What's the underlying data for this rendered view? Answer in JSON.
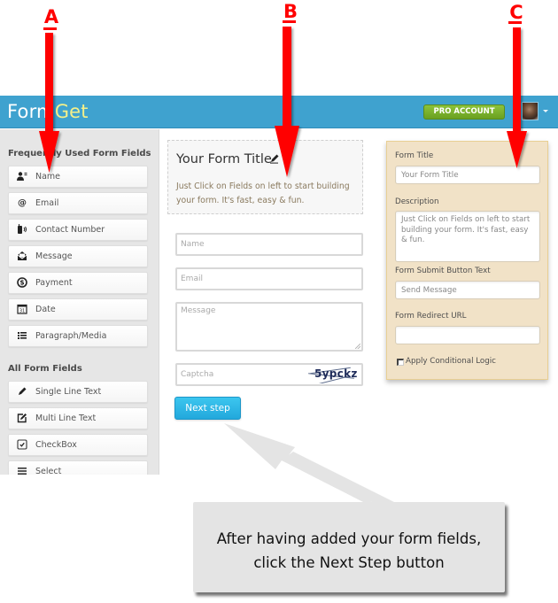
{
  "annotations": {
    "markers": [
      {
        "letter": "A",
        "target": "frequently-used-fields"
      },
      {
        "letter": "B",
        "target": "form-preview"
      },
      {
        "letter": "C",
        "target": "form-settings"
      }
    ],
    "marker_color": "#ff0000",
    "callout": {
      "line1": "After having added your form fields,",
      "line2": "click the Next Step button"
    }
  },
  "app": {
    "logo": {
      "part1": "Form",
      "part2": "Get"
    },
    "header": {
      "pro_button": "PRO ACCOUNT",
      "brand_color": "#3fa2cf",
      "pro_color": "#7ab32e"
    },
    "sidebar": {
      "frequent_title": "Frequently Used Form Fields",
      "frequent_items": [
        {
          "label": "Name",
          "icon": "user-card-icon"
        },
        {
          "label": "Email",
          "icon": "at-sign-icon"
        },
        {
          "label": "Contact Number",
          "icon": "phone-icon"
        },
        {
          "label": "Message",
          "icon": "envelope-icon"
        },
        {
          "label": "Payment",
          "icon": "dollar-icon"
        },
        {
          "label": "Date",
          "icon": "calendar-icon"
        },
        {
          "label": "Paragraph/Media",
          "icon": "paragraph-list-icon"
        }
      ],
      "all_title": "All Form Fields",
      "all_items": [
        {
          "label": "Single Line Text",
          "icon": "pencil-icon"
        },
        {
          "label": "Multi Line Text",
          "icon": "edit-box-icon"
        },
        {
          "label": "CheckBox",
          "icon": "checkbox-icon"
        },
        {
          "label": "Select",
          "icon": "list-lines-icon"
        }
      ]
    },
    "preview": {
      "title": "Your Form Title",
      "description": "Just Click on Fields on left to start building your form. It's fast, easy & fun.",
      "fields": {
        "name_placeholder": "Name",
        "email_placeholder": "Email",
        "message_placeholder": "Message",
        "captcha_placeholder": "Captcha",
        "captcha_code": "5ypckz"
      },
      "next_button": "Next step",
      "next_color": "#2cb4e4"
    },
    "settings": {
      "form_title_label": "Form Title",
      "form_title_placeholder": "Your Form Title",
      "description_label": "Description",
      "description_value": "Just Click on Fields on left to start building your form. It's fast, easy & fun.",
      "submit_label": "Form Submit Button Text",
      "submit_placeholder": "Send Message",
      "redirect_label": "Form Redirect URL",
      "redirect_value": "",
      "conditional_label": "Apply Conditional Logic",
      "conditional_checked": false,
      "panel_color": "#f1e2c7"
    }
  }
}
